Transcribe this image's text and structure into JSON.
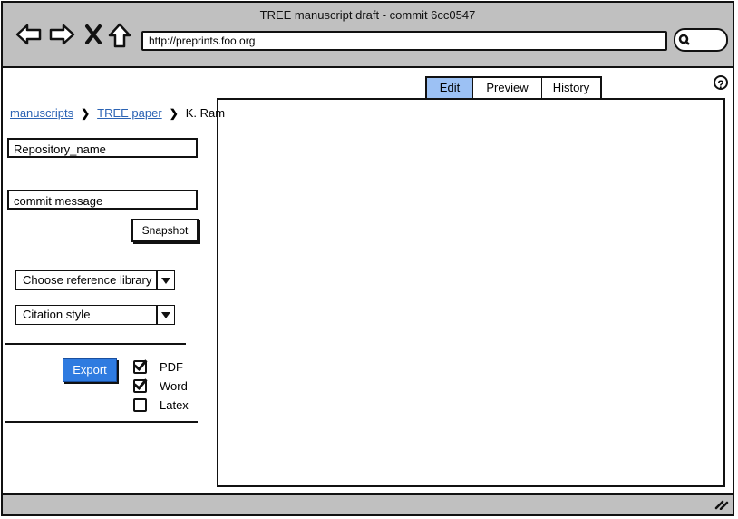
{
  "window": {
    "title": "TREE manuscript draft - commit 6cc0547",
    "url": "http://preprints.foo.org",
    "nav_icons": [
      "back-arrow-icon",
      "forward-arrow-icon",
      "close-x-icon",
      "home-icon"
    ]
  },
  "breadcrumb": {
    "items": [
      {
        "label": "manuscripts",
        "link": true
      },
      {
        "label": "TREE paper",
        "link": true
      },
      {
        "label": "K. Ram",
        "link": false
      }
    ],
    "separator": "❯"
  },
  "sidebar": {
    "repository_field": "Repository_name",
    "commit_field": "commit message",
    "snapshot_button": "Snapshot",
    "reference_select": "Choose reference library",
    "citation_select": "Citation style",
    "export_button": "Export",
    "export_color": "#2f7be0",
    "formats": [
      {
        "label": "PDF",
        "checked": true
      },
      {
        "label": "Word",
        "checked": true
      },
      {
        "label": "Latex",
        "checked": false
      }
    ]
  },
  "tabs": [
    {
      "label": "Edit",
      "active": true
    },
    {
      "label": "Preview",
      "active": false
    },
    {
      "label": "History",
      "active": false
    }
  ],
  "help": "?"
}
